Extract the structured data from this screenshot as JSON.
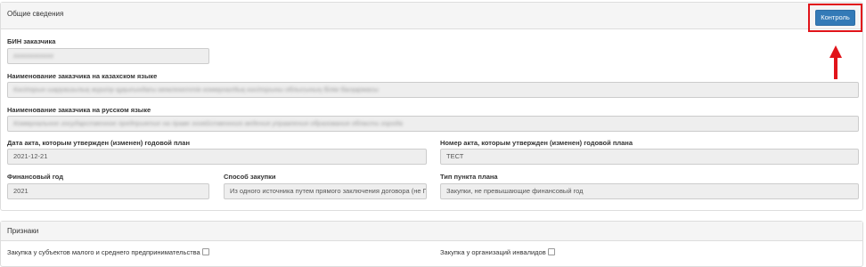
{
  "general": {
    "title": "Общие сведения",
    "control_button": "Контроль",
    "bin_label": "БИН заказчика",
    "bin_value": "xxxxxxxxxxxx",
    "name_kz_label": "Наименование заказчика на казахском языке",
    "name_kz_value": "Кәсіпорын шаруашылық жүргізу құқығындағы мемлекеттік коммуналдық кәсіпорыны облысының білім басқармасы",
    "name_ru_label": "Наименование заказчика на русском языке",
    "name_ru_value": "Коммунальное государственное предприятие на праве хозяйственного ведения управления образования области города",
    "act_date_label": "Дата акта, которым утвержден (изменен) годовой план",
    "act_date_value": "2021-12-21",
    "act_number_label": "Номер акта, которым утвержден (изменен) годовой плана",
    "act_number_value": "ТЕСТ",
    "fin_year_label": "Финансовый год",
    "fin_year_value": "2021",
    "method_label": "Способ закупки",
    "method_value": "Из одного источника путем прямого заключения договора (не Г",
    "item_type_label": "Тип пункта плана",
    "item_type_value": "Закупки, не превышающие финансовый год"
  },
  "signs": {
    "title": "Признаки",
    "sme_label": "Закупка у субъектов малого и среднего предпринимательства",
    "disabled_org_label": "Закупка у организаций инвалидов"
  },
  "colors": {
    "accent": "#337ab7",
    "annotation": "#e1141a"
  },
  "icons": {
    "annotation_arrow": "arrow-up-icon"
  }
}
